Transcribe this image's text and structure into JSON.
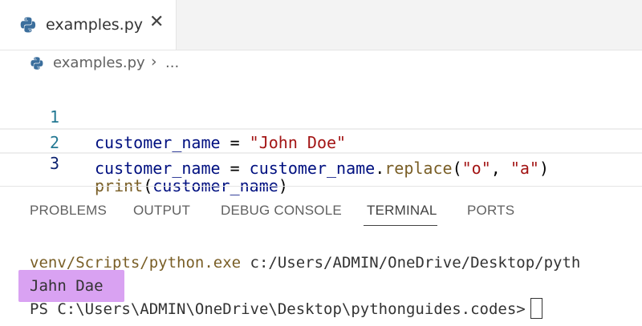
{
  "editor_tab": {
    "filename": "examples.py",
    "close_glyph": "✕"
  },
  "breadcrumb": {
    "file": "examples.py",
    "separator": "›",
    "more": "..."
  },
  "code_lines": [
    {
      "number": "1",
      "tokens": [
        [
          "var",
          "customer_name"
        ],
        [
          "op",
          " = "
        ],
        [
          "str",
          "\"John Doe\""
        ]
      ]
    },
    {
      "number": "2",
      "tokens": [
        [
          "var",
          "customer_name"
        ],
        [
          "op",
          " = "
        ],
        [
          "var",
          "customer_name"
        ],
        [
          "op",
          "."
        ],
        [
          "fn",
          "replace"
        ],
        [
          "op",
          "("
        ],
        [
          "str",
          "\"o\""
        ],
        [
          "op",
          ", "
        ],
        [
          "str",
          "\"a\""
        ],
        [
          "op",
          ")"
        ]
      ]
    },
    {
      "number": "3",
      "tokens": [
        [
          "fn",
          "print"
        ],
        [
          "op",
          "("
        ],
        [
          "var",
          "customer_name"
        ],
        [
          "op",
          ")"
        ]
      ]
    }
  ],
  "panel_tabs": [
    "PROBLEMS",
    "OUTPUT",
    "DEBUG CONSOLE",
    "TERMINAL",
    "PORTS"
  ],
  "active_panel_tab": "TERMINAL",
  "terminal": {
    "command_script": "venv/Scripts/python.exe",
    "command_args": " c:/Users/ADMIN/OneDrive/Desktop/pyth",
    "output": "Jahn Dae",
    "prompt": "PS C:\\Users\\ADMIN\\OneDrive\\Desktop\\pythonguides.codes>"
  },
  "colors": {
    "highlight": "#d9a2f2",
    "line_number": "#237893",
    "variable": "#001080",
    "string": "#a31515",
    "function": "#795e26"
  },
  "icons": {
    "file_type": "python-file-icon",
    "close": "close-icon"
  }
}
